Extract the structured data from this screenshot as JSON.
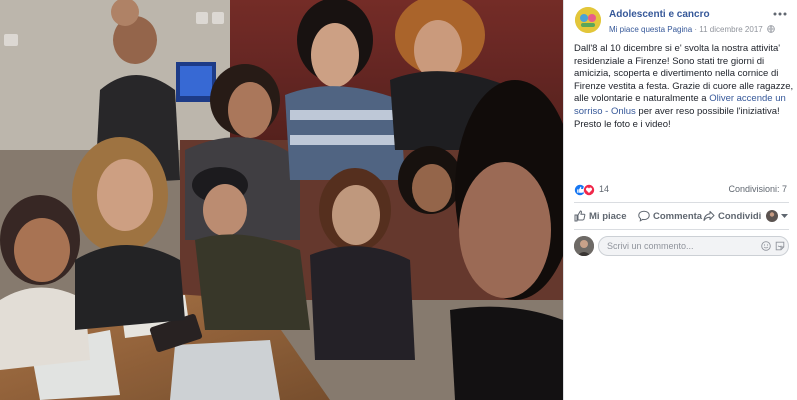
{
  "post": {
    "page_name": "Adolescenti e cancro",
    "like_page": "Mi piace questa Pagina",
    "separator": " · ",
    "date": "11 dicembre 2017",
    "text_before": "Dall'8 al 10 dicembre si e' svolta la nostra attivita' residenziale a Firenze! Sono stati tre giorni di amicizia, scoperta e divertimento nella cornice di Firenze vestita a festa. Grazie di cuore alle ragazze, alle volontarie e naturalmente a ",
    "link_text": "Oliver accende un sorriso - Onlus",
    "text_after": " per aver reso possibile l'iniziativa! Presto le foto e i video!"
  },
  "reactions": {
    "count": "14",
    "icons": [
      "like-reaction-icon",
      "love-reaction-icon"
    ],
    "like_color": "#1877f2",
    "love_color": "#f0284a"
  },
  "shares": "Condivisioni: 7",
  "actions": {
    "like": "Mi piace",
    "comment": "Commenta",
    "share": "Condividi"
  },
  "comment": {
    "placeholder": "Scrivi un commento..."
  },
  "colors": {
    "link": "#365899",
    "meta": "#90949c",
    "action": "#606770"
  }
}
